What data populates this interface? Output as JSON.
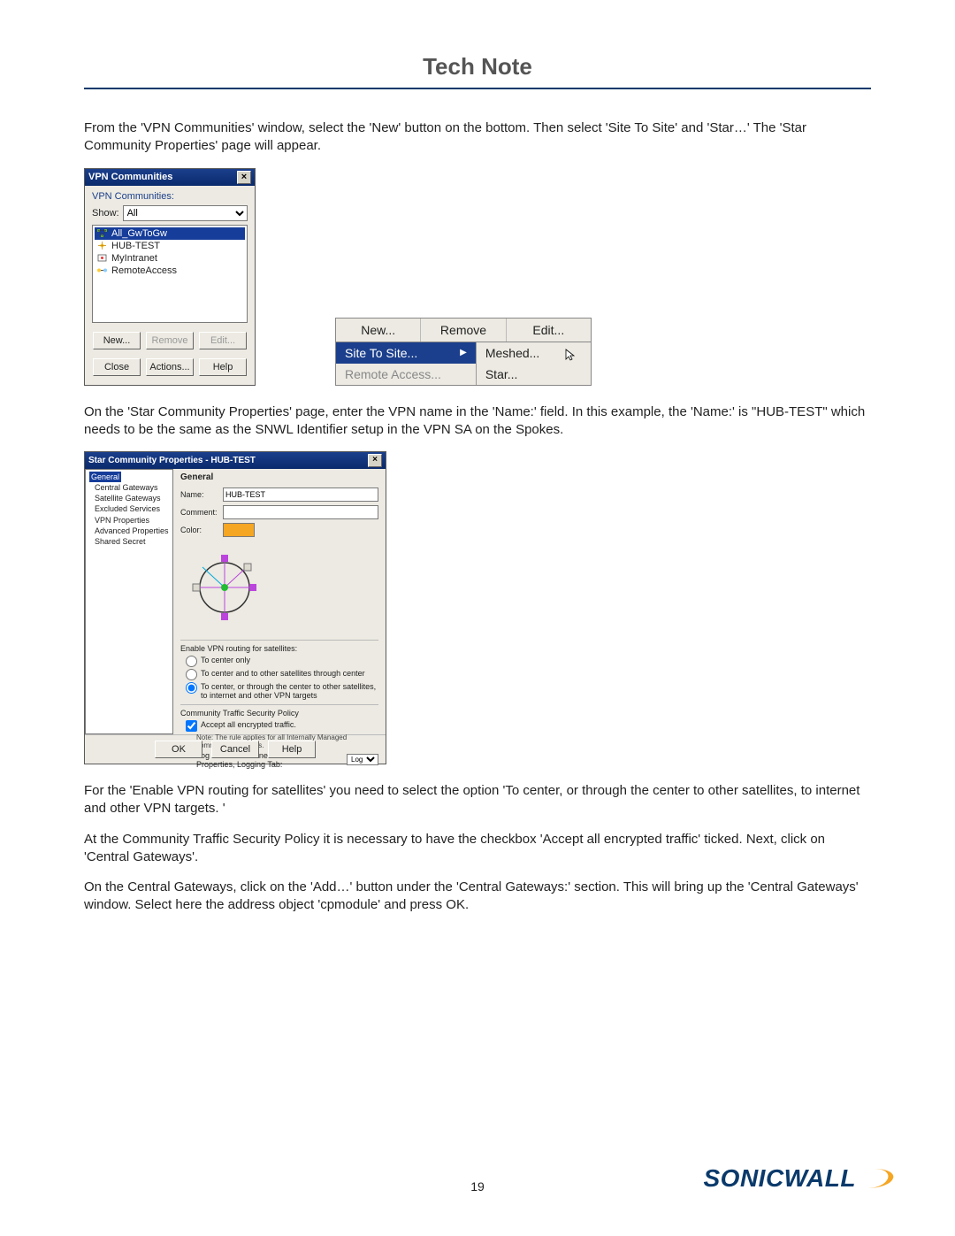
{
  "header": {
    "title": "Tech Note"
  },
  "para1": "From the 'VPN Communities' window, select the 'New' button on the bottom. Then select 'Site To Site' and 'Star…' The 'Star Community Properties' page will appear.",
  "vpn_win": {
    "title": "VPN Communities",
    "group_label": "VPN Communities:",
    "show_label": "Show:",
    "show_value": "All",
    "items": [
      "All_GwToGw",
      "HUB-TEST",
      "MyIntranet",
      "RemoteAccess"
    ],
    "btn_new": "New...",
    "btn_remove": "Remove",
    "btn_edit": "Edit...",
    "btn_close": "Close",
    "btn_actions": "Actions...",
    "btn_help": "Help"
  },
  "tri": {
    "new": "New...",
    "remove": "Remove",
    "edit": "Edit...",
    "site_to_site": "Site To Site...",
    "remote_access": "Remote Access...",
    "meshed": "Meshed...",
    "star": "Star..."
  },
  "para2": "On the 'Star Community Properties' page, enter the VPN name in the 'Name:' field. In this example, the 'Name:' is \"HUB-TEST\" which needs to be the same as the SNWL Identifier setup in the VPN SA on the Spokes.",
  "star": {
    "title": "Star Community Properties - HUB-TEST",
    "tree": [
      "General",
      "Central Gateways",
      "Satellite Gateways",
      "Excluded Services",
      "VPN Properties",
      "Advanced Properties",
      "Shared Secret"
    ],
    "section": "General",
    "name_label": "Name:",
    "name_value": "HUB-TEST",
    "comment_label": "Comment:",
    "comment_value": "",
    "color_label": "Color:",
    "routing_title": "Enable VPN routing for satellites:",
    "opt1": "To center only",
    "opt2": "To center and to other satellites through center",
    "opt3": "To center, or through the center to other satellites, to internet and other VPN targets",
    "sec_title": "Community Traffic Security Policy",
    "accept": "Accept all encrypted traffic.",
    "accept_note": "Note: The rule applies for all Internally Managed community members.",
    "log_label": "Log Traffic as defined in Global Properties, Logging Tab:",
    "log_value": "Log",
    "ok": "OK",
    "cancel": "Cancel",
    "help": "Help"
  },
  "para3": "For the 'Enable VPN routing for satellites' you need to select the option 'To center, or through the center to other satellites, to internet and other VPN targets. '",
  "para4": "At the Community Traffic Security Policy it is necessary to have the checkbox 'Accept all encrypted traffic' ticked. Next, click on 'Central Gateways'.",
  "para5": "On the Central Gateways, click on the 'Add…' button under the 'Central Gateways:' section. This will bring up the 'Central Gateways' window. Select here the address object 'cpmodule' and press OK.",
  "footer": {
    "page": "19",
    "brand": "SONICWALL"
  }
}
